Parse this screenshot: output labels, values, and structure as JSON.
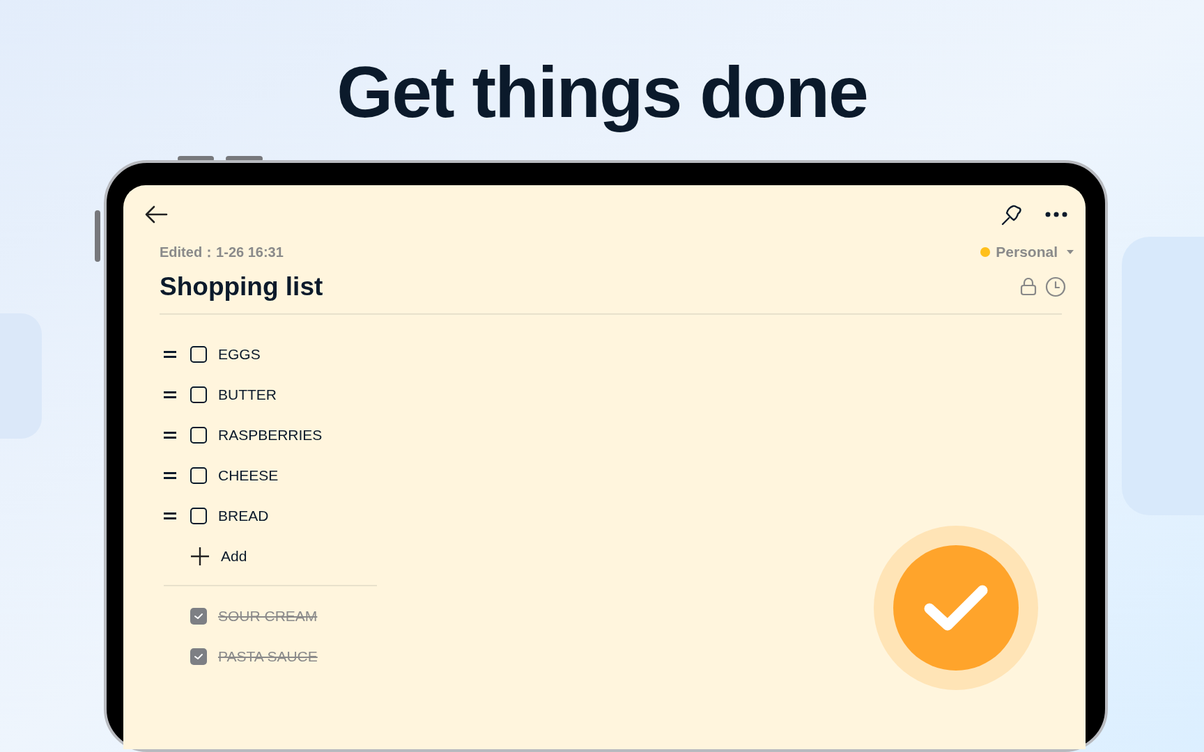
{
  "headline": "Get things done",
  "note": {
    "edited": "Edited：1-26 16:31",
    "title": "Shopping list",
    "category": {
      "label": "Personal",
      "color": "#ffbf1a"
    }
  },
  "items": [
    {
      "text": "EGGS",
      "checked": false
    },
    {
      "text": "BUTTER",
      "checked": false
    },
    {
      "text": "RASPBERRIES",
      "checked": false
    },
    {
      "text": "CHEESE",
      "checked": false
    },
    {
      "text": "BREAD",
      "checked": false
    }
  ],
  "add_label": "Add",
  "done_items": [
    {
      "text": "SOUR CREAM",
      "checked": true
    },
    {
      "text": "PASTA SAUCE",
      "checked": true
    }
  ]
}
